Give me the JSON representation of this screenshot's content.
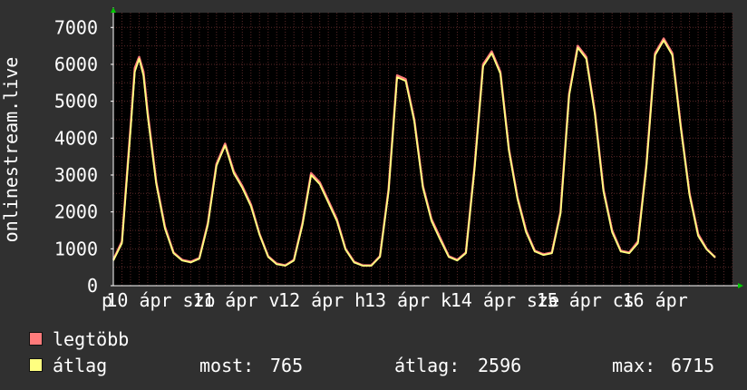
{
  "colors": {
    "background": "#303030",
    "plot_bg": "#000000",
    "grid": "#5a2828",
    "axis_text": "#ffffff",
    "max_series": "#ff7b7b",
    "avg_series": "#ffff80",
    "axis_arrow": "#00c800"
  },
  "chart_data": {
    "type": "line",
    "ylabel": "onlinestream.live",
    "ylim": [
      0,
      7400
    ],
    "yticks": [
      0,
      1000,
      2000,
      3000,
      4000,
      5000,
      6000,
      7000
    ],
    "ytick_labels": [
      "0",
      "1000",
      "2000",
      "3000",
      "4000",
      "5000",
      "6000",
      "7000"
    ],
    "xlim": [
      0,
      7.2
    ],
    "xtick_positions": [
      0.3,
      1.3,
      2.3,
      3.3,
      4.3,
      5.3,
      6.3
    ],
    "xtick_labels": [
      "10 ápr",
      "11 ápr",
      "12 ápr",
      "13 ápr",
      "14 ápr",
      "15 ápr",
      "16 ápr"
    ],
    "weekday_labels": [
      "p",
      "szo",
      "v",
      "h",
      "k",
      "sze",
      "cs"
    ],
    "grid": true,
    "legend_position": "bottom-left",
    "series": [
      {
        "name": "legtöbb",
        "color": "#ff7b7b",
        "x": [
          0.0,
          0.1,
          0.2,
          0.25,
          0.3,
          0.35,
          0.4,
          0.5,
          0.6,
          0.7,
          0.8,
          0.9,
          1.0,
          1.1,
          1.2,
          1.3,
          1.4,
          1.5,
          1.6,
          1.7,
          1.8,
          1.9,
          2.0,
          2.1,
          2.2,
          2.3,
          2.4,
          2.5,
          2.6,
          2.7,
          2.8,
          2.9,
          3.0,
          3.1,
          3.2,
          3.3,
          3.4,
          3.5,
          3.6,
          3.7,
          3.8,
          3.9,
          4.0,
          4.1,
          4.2,
          4.3,
          4.4,
          4.5,
          4.6,
          4.7,
          4.8,
          4.9,
          5.0,
          5.1,
          5.2,
          5.3,
          5.4,
          5.5,
          5.6,
          5.7,
          5.8,
          5.9,
          6.0,
          6.1,
          6.2,
          6.3,
          6.4,
          6.5,
          6.6,
          6.7,
          6.8,
          6.9,
          7.0
        ],
        "values": [
          700,
          1200,
          4300,
          5900,
          6200,
          5800,
          4700,
          2800,
          1600,
          900,
          700,
          650,
          750,
          1700,
          3300,
          3850,
          3100,
          2700,
          2200,
          1400,
          800,
          600,
          550,
          700,
          1700,
          3050,
          2800,
          2300,
          1800,
          1000,
          650,
          550,
          550,
          800,
          2600,
          5700,
          5600,
          4500,
          2700,
          1800,
          1300,
          800,
          700,
          900,
          3200,
          6000,
          6350,
          5800,
          3700,
          2400,
          1500,
          950,
          850,
          900,
          2000,
          5200,
          6500,
          6200,
          4700,
          2600,
          1500,
          950,
          900,
          1200,
          3300,
          6300,
          6700,
          6300,
          4300,
          2500,
          1400,
          1000,
          765
        ]
      },
      {
        "name": "átlag",
        "color": "#ffff80",
        "x": [
          0.0,
          0.1,
          0.2,
          0.25,
          0.3,
          0.35,
          0.4,
          0.5,
          0.6,
          0.7,
          0.8,
          0.9,
          1.0,
          1.1,
          1.2,
          1.3,
          1.4,
          1.5,
          1.6,
          1.7,
          1.8,
          1.9,
          2.0,
          2.1,
          2.2,
          2.3,
          2.4,
          2.5,
          2.6,
          2.7,
          2.8,
          2.9,
          3.0,
          3.1,
          3.2,
          3.3,
          3.4,
          3.5,
          3.6,
          3.7,
          3.8,
          3.9,
          4.0,
          4.1,
          4.2,
          4.3,
          4.4,
          4.5,
          4.6,
          4.7,
          4.8,
          4.9,
          5.0,
          5.1,
          5.2,
          5.3,
          5.4,
          5.5,
          5.6,
          5.7,
          5.8,
          5.9,
          6.0,
          6.1,
          6.2,
          6.3,
          6.4,
          6.5,
          6.6,
          6.7,
          6.8,
          6.9,
          7.0
        ],
        "values": [
          680,
          1150,
          4200,
          5800,
          6150,
          5700,
          4600,
          2750,
          1550,
          880,
          680,
          630,
          730,
          1650,
          3250,
          3800,
          3050,
          2650,
          2150,
          1380,
          780,
          580,
          540,
          680,
          1650,
          3000,
          2750,
          2250,
          1750,
          980,
          630,
          540,
          540,
          780,
          2550,
          5650,
          5550,
          4450,
          2650,
          1750,
          1250,
          780,
          680,
          880,
          3150,
          5950,
          6300,
          5750,
          3650,
          2350,
          1450,
          930,
          830,
          880,
          1950,
          5150,
          6450,
          6150,
          4650,
          2550,
          1450,
          930,
          880,
          1150,
          3250,
          6250,
          6650,
          6250,
          4250,
          2450,
          1350,
          980,
          765
        ]
      }
    ],
    "stats": {
      "now_label": "most:",
      "now_value": "765",
      "avg_label": "átlag:",
      "avg_value": "2596",
      "max_label": "max:",
      "max_value": "6715"
    }
  }
}
